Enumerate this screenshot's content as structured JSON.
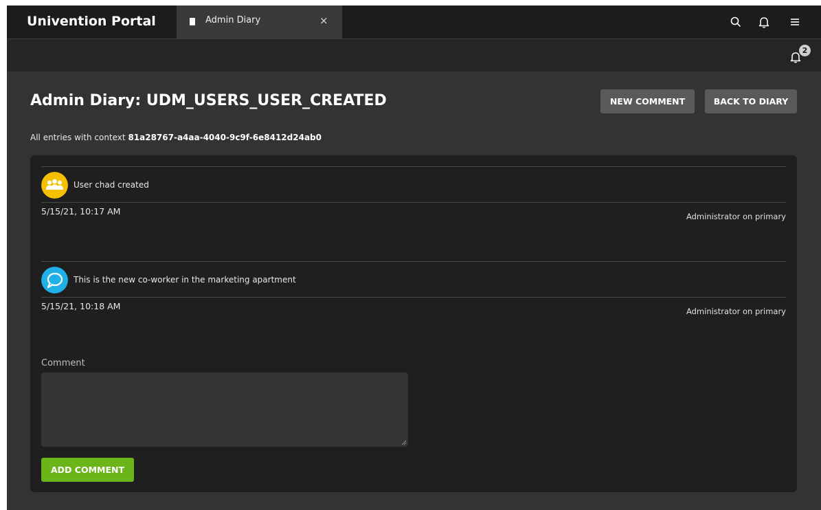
{
  "header": {
    "brand": "Univention Portal",
    "tab": {
      "label": "Admin Diary",
      "close_glyph": "×",
      "icon": "book-icon"
    },
    "icons": [
      "search-icon",
      "bell-icon",
      "menu-icon"
    ]
  },
  "notifications": {
    "count": "2",
    "icon": "bell-icon"
  },
  "page": {
    "title": "Admin Diary: UDM_USERS_USER_CREATED",
    "new_comment_label": "NEW COMMENT",
    "back_label": "BACK TO DIARY",
    "context_prefix": "All entries with context",
    "context_id": "81a28767-a4aa-4040-9c9f-6e8412d24ab0"
  },
  "entries": [
    {
      "icon": "users-icon",
      "icon_color": "#f5c000",
      "message": "User chad created",
      "date": "5/15/21, 10:17 AM",
      "author": "Administrator on primary"
    },
    {
      "icon": "comment-icon",
      "icon_color": "#1fb0e8",
      "message": "This is the new co-worker in the marketing apartment",
      "date": "5/15/21, 10:18 AM",
      "author": "Administrator on primary"
    }
  ],
  "comment_form": {
    "label": "Comment",
    "value": "",
    "submit_label": "ADD COMMENT"
  },
  "colors": {
    "header_bg": "#1c1c1c",
    "page_bg": "#333333",
    "card_bg": "#1f1f1f",
    "accent_green": "#6bb51b",
    "button_gray": "#5a5a5a"
  }
}
